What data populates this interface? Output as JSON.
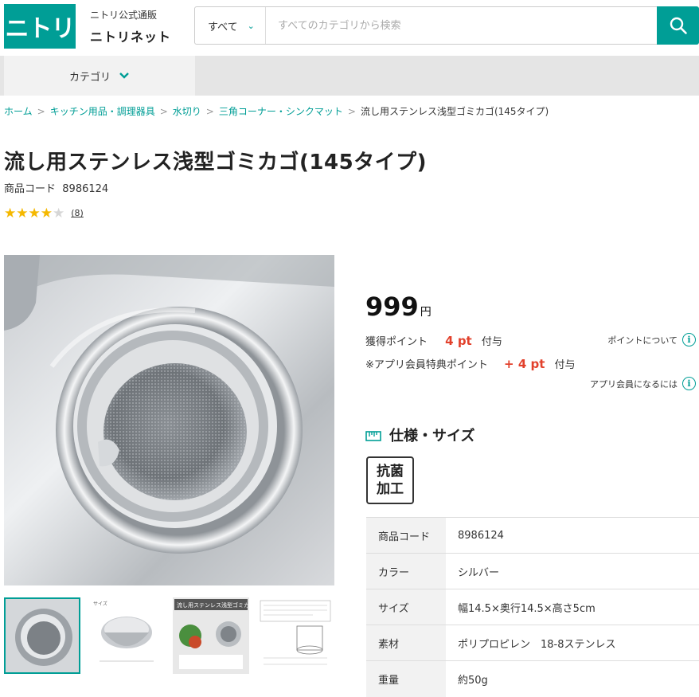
{
  "header": {
    "logo_text": "ニトリ",
    "brand_sub": "ニトリ公式通販",
    "brand_name": "ニトリネット",
    "search_category": "すべて",
    "search_placeholder": "すべてのカテゴリから検索"
  },
  "nav": {
    "category_label": "カテゴリ"
  },
  "breadcrumb": {
    "items": [
      "ホーム",
      "キッチン用品・調理器具",
      "水切り",
      "三角コーナー・シンクマット"
    ],
    "current": "流し用ステンレス浅型ゴミカゴ(145タイプ)",
    "separator": ">"
  },
  "product": {
    "title": "流し用ステンレス浅型ゴミカゴ(145タイプ)",
    "code_label": "商品コード",
    "code": "8986124",
    "rating": 4,
    "rating_max": 5,
    "review_count": "(8)",
    "price": "999",
    "currency": "円"
  },
  "points": {
    "earned_label": "獲得ポイント",
    "earned_value": "4 pt",
    "earned_suffix": "付与",
    "info_link": "ポイントについて",
    "app_label": "※アプリ会員特典ポイント",
    "app_value": "+ 4 pt",
    "app_suffix": "付与",
    "app_link": "アプリ会員になるには"
  },
  "spec": {
    "heading": "仕様・サイズ",
    "badge_line1": "抗菌",
    "badge_line2": "加工",
    "rows": [
      {
        "key": "商品コード",
        "value": "8986124"
      },
      {
        "key": "カラー",
        "value": "シルバー"
      },
      {
        "key": "サイズ",
        "value": "幅14.5×奥行14.5×高さ5cm"
      },
      {
        "key": "素材",
        "value": "ポリプロピレン　18-8ステンレス"
      },
      {
        "key": "重量",
        "value": "約50g"
      }
    ]
  },
  "thumbnails": {
    "thumb3_caption": "流し用ステンレス浅型ゴミカゴ"
  },
  "colors": {
    "brand": "#009e96",
    "point": "#e2412c",
    "star": "#f5b800"
  }
}
